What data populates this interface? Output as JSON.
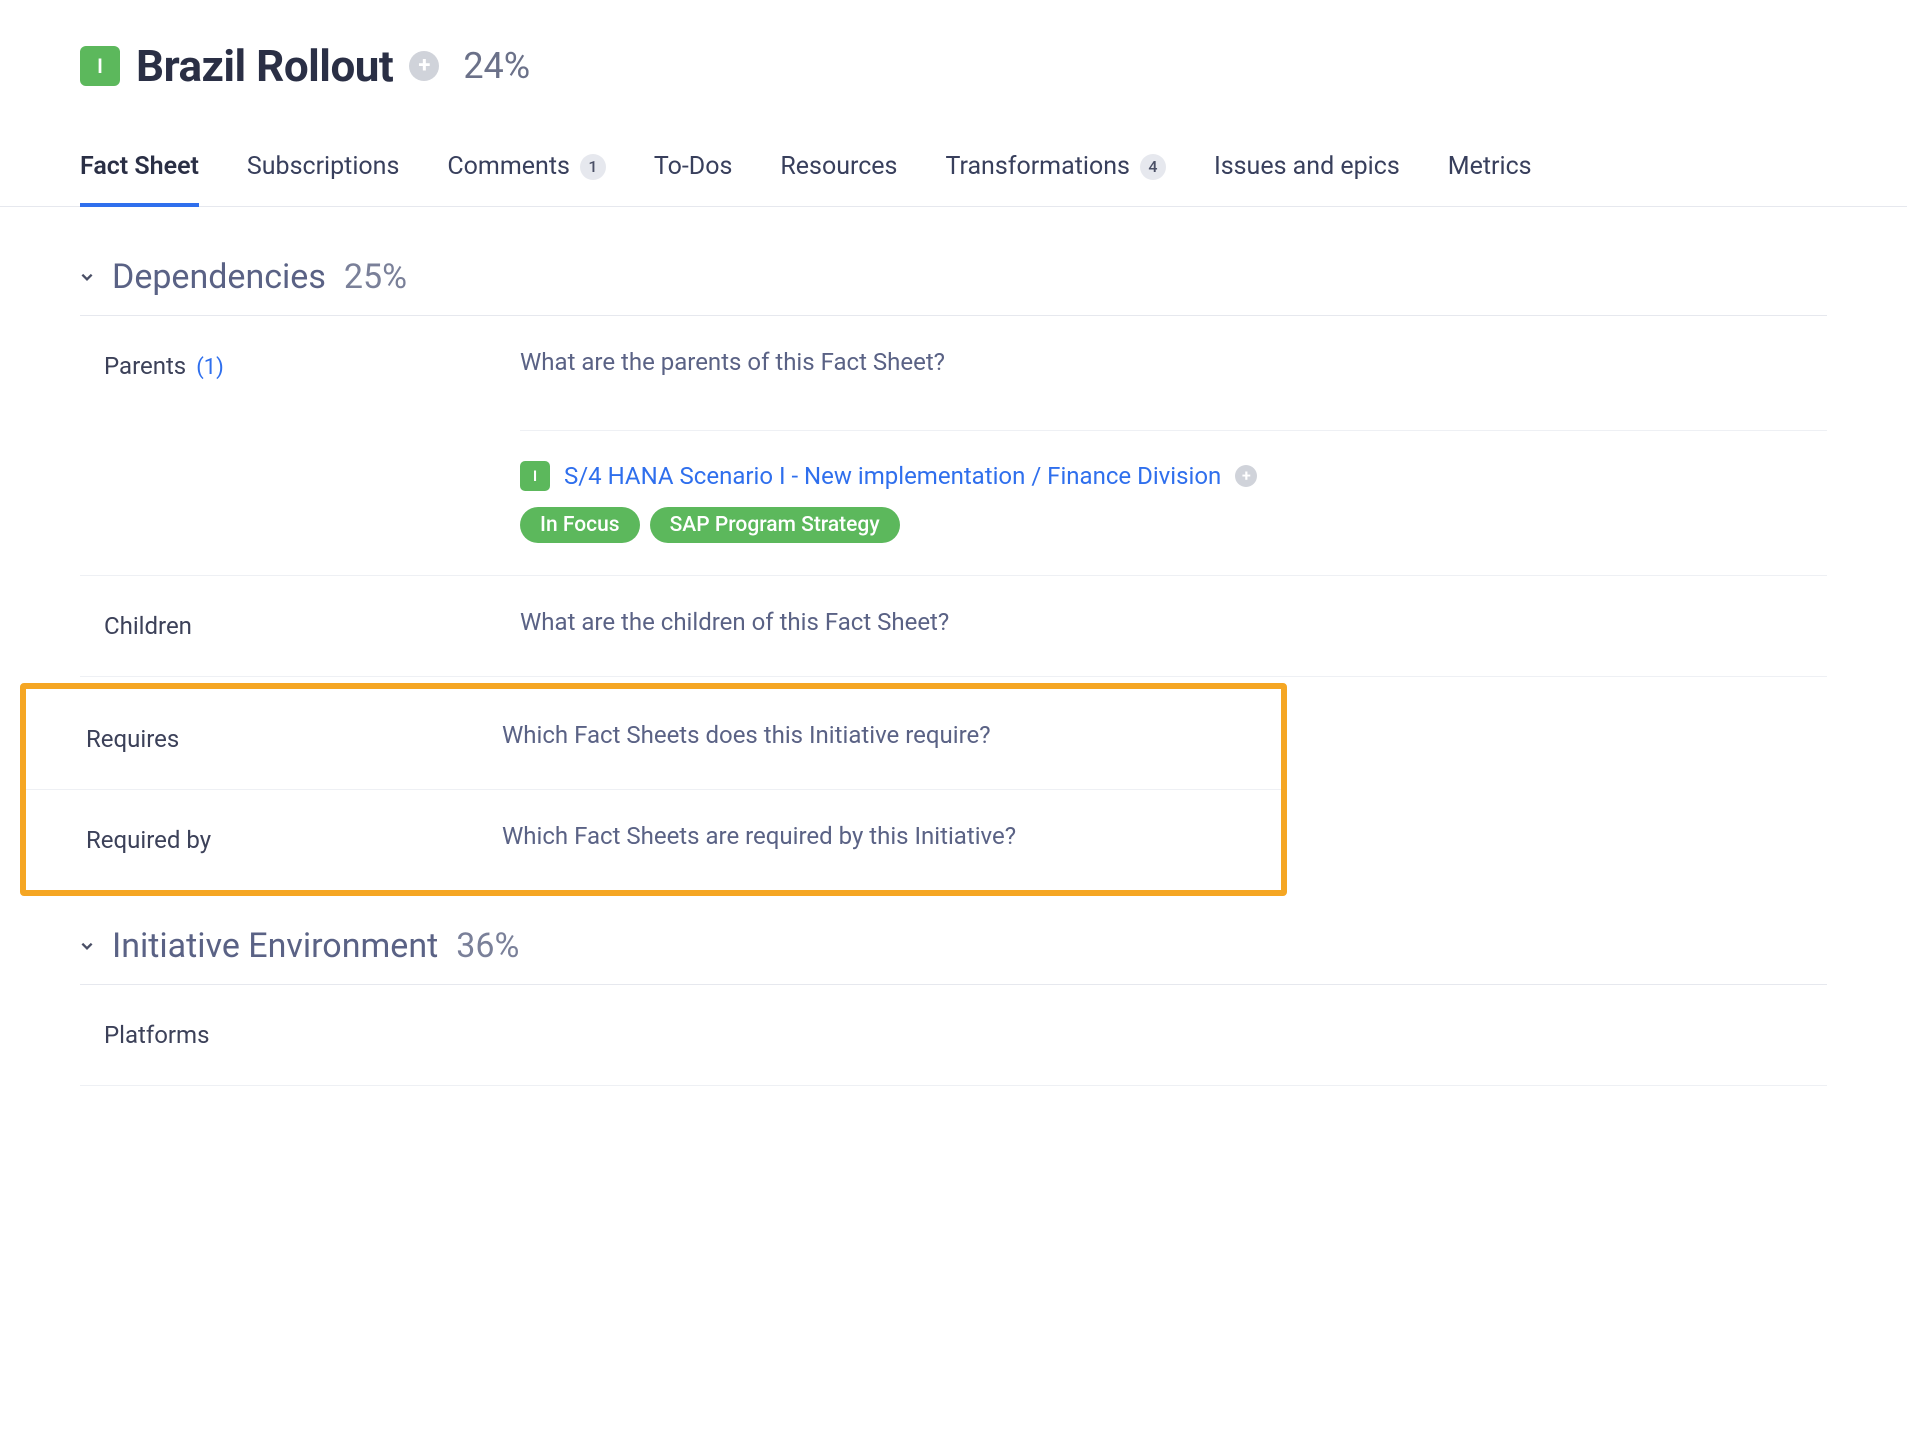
{
  "header": {
    "typeBadge": "I",
    "title": "Brazil Rollout",
    "completion": "24%"
  },
  "tabs": [
    {
      "label": "Fact Sheet",
      "badge": null,
      "active": true
    },
    {
      "label": "Subscriptions",
      "badge": null,
      "active": false
    },
    {
      "label": "Comments",
      "badge": "1",
      "active": false
    },
    {
      "label": "To-Dos",
      "badge": null,
      "active": false
    },
    {
      "label": "Resources",
      "badge": null,
      "active": false
    },
    {
      "label": "Transformations",
      "badge": "4",
      "active": false
    },
    {
      "label": "Issues and epics",
      "badge": null,
      "active": false
    },
    {
      "label": "Metrics",
      "badge": null,
      "active": false
    }
  ],
  "sections": {
    "dependencies": {
      "title": "Dependencies",
      "pct": "25%",
      "parents": {
        "label": "Parents",
        "count": "(1)",
        "placeholder": "What are the parents of this Fact Sheet?",
        "item": {
          "badge": "I",
          "link": "S/4 HANA Scenario I - New implementation / Finance Division",
          "tags": [
            "In Focus",
            "SAP Program Strategy"
          ]
        }
      },
      "children": {
        "label": "Children",
        "placeholder": "What are the children of this Fact Sheet?"
      },
      "requires": {
        "label": "Requires",
        "placeholder": "Which Fact Sheets does this Initiative require?"
      },
      "requiredBy": {
        "label": "Required by",
        "placeholder": "Which Fact Sheets are required by this Initiative?"
      }
    },
    "initiativeEnv": {
      "title": "Initiative Environment",
      "pct": "36%",
      "platforms": {
        "label": "Platforms"
      }
    }
  }
}
